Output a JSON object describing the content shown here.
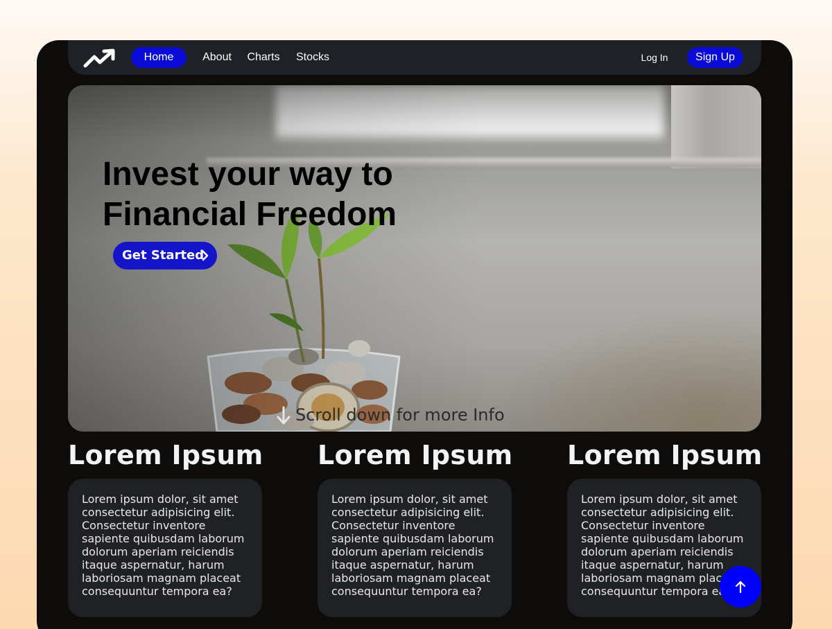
{
  "nav": {
    "logo_icon": "trending-up-icon",
    "links": [
      {
        "label": "Home",
        "active": true
      },
      {
        "label": "About",
        "active": false
      },
      {
        "label": "Charts",
        "active": false
      },
      {
        "label": "Stocks",
        "active": false
      }
    ],
    "login_label": "Log In",
    "signup_label": "Sign Up"
  },
  "hero": {
    "title_line1": "Invest your way to",
    "title_line2": "Financial Freedom",
    "cta_label": "Get Started",
    "scroll_hint": "Scroll down for more Info"
  },
  "features": [
    {
      "title": "Lorem Ipsum",
      "body": "Lorem ipsum dolor, sit amet consectetur adipisicing elit. Consectetur inventore sapiente quibusdam laborum dolorum aperiam reiciendis itaque aspernatur, harum laboriosam magnam placeat consequuntur tempora ea?"
    },
    {
      "title": "Lorem Ipsum",
      "body": "Lorem ipsum dolor, sit amet consectetur adipisicing elit. Consectetur inventore sapiente quibusdam laborum dolorum aperiam reiciendis itaque aspernatur, harum laboriosam magnam placeat consequuntur tempora ea?"
    },
    {
      "title": "Lorem Ipsum",
      "body": "Lorem ipsum dolor, sit amet consectetur adipisicing elit. Consectetur inventore sapiente quibusdam laborum dolorum aperiam reiciendis itaque aspernatur, harum laboriosam magnam placeat consequuntur tempora ea?"
    }
  ],
  "colors": {
    "accent": "#0a0ad6",
    "fab": "#0000ff",
    "frame": "#0d0c0b",
    "card": "#1f2124"
  },
  "fab_icon": "arrow-up-icon"
}
